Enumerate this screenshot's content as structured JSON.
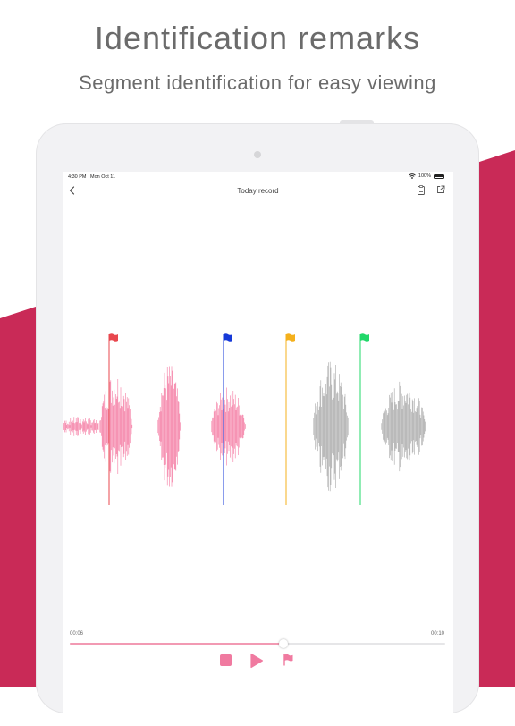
{
  "headline": "Identification remarks",
  "subheadline": "Segment identification for easy viewing",
  "colors": {
    "brand_band": "#c92a57",
    "played_wave": "#f47aa2",
    "unplayed_wave": "#a8a8a8",
    "accent": "#f07aa0"
  },
  "status_bar": {
    "time": "4:30 PM",
    "date": "Mon Oct 11",
    "battery": "100%",
    "icons": [
      "wifi-icon",
      "battery-icon"
    ]
  },
  "nav": {
    "title": "Today record",
    "icons": [
      "back-chevron-icon",
      "clipboard-icon",
      "share-icon"
    ]
  },
  "markers": [
    {
      "color": "#e8474e",
      "icon": "flag-icon"
    },
    {
      "color": "#1639d8",
      "icon": "flag-icon"
    },
    {
      "color": "#f4b01c",
      "icon": "flag-icon"
    },
    {
      "color": "#21d86a",
      "icon": "flag-icon"
    }
  ],
  "player": {
    "time_start": "00:06",
    "time_end": "00:10",
    "progress": 0.57,
    "icons": [
      "stop-icon",
      "play-icon",
      "flag-icon"
    ]
  }
}
